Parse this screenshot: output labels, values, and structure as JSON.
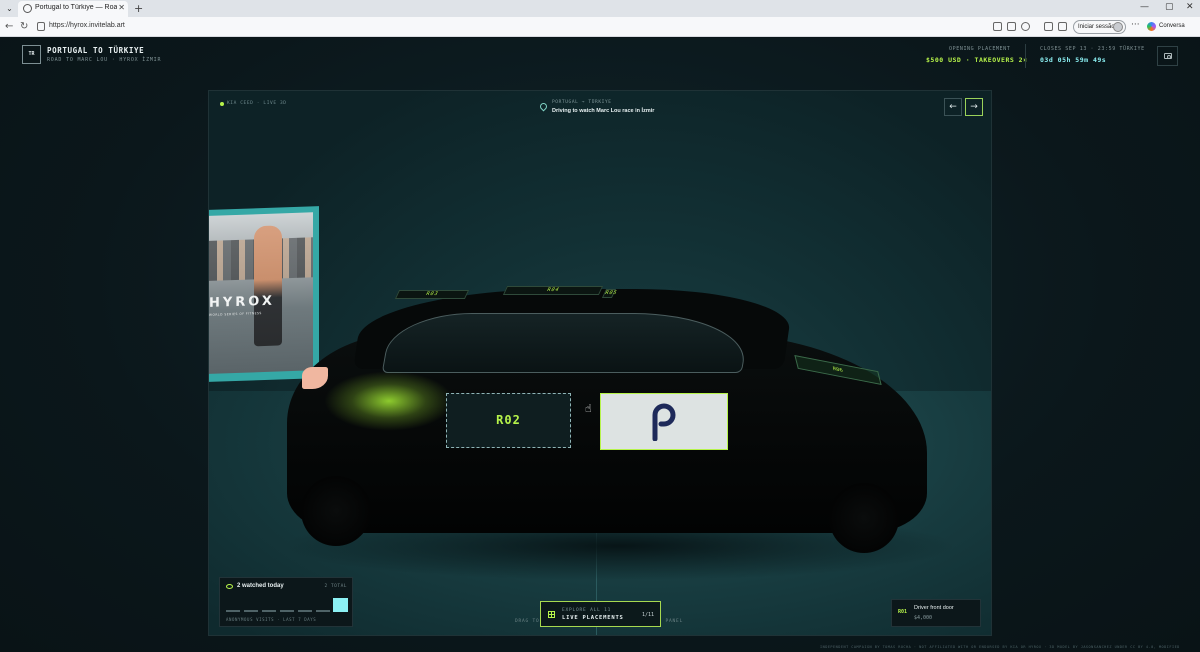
{
  "browser": {
    "tab_title": "Portugal to Türkiye — Road Trip S",
    "url": "https://hyrox.invitelab.art",
    "signin_label": "Iniciar sessão",
    "copilot_label": "Conversa"
  },
  "header": {
    "logo": "TR",
    "title": "PORTUGAL TO TÜRKIYE",
    "subtitle": "ROAD TO MARC LOU · HYROX İZMIR",
    "placement_label": "OPENING PLACEMENT",
    "placement_value": "$500 USD · TAKEOVERS 2×",
    "closes_label": "CLOSES SEP 13 · 23:59 TÜRKIYE",
    "countdown": "03d 05h 59m 49s"
  },
  "stage": {
    "live_text": "KIA CEED · LIVE 3D",
    "route_label": "PORTUGAL → TÜRKIYE",
    "route_title": "Driving to watch Marc Lou race in İzmir",
    "prev_arrow": "←",
    "next_arrow": "→",
    "billboard_brand": "HYROX",
    "billboard_sub": "WORLD SERIES OF FITNESS",
    "roof_slots": [
      "R03",
      "R04",
      "R05"
    ],
    "hood_slot": "R06",
    "slot_r02_label": "R02"
  },
  "watch": {
    "title": "2 watched today",
    "total": "2 TOTAL",
    "footer": "ANONYMOUS VISITS · LAST 7 DAYS",
    "days": [
      0,
      0,
      0,
      0,
      0,
      0,
      2
    ]
  },
  "explore": {
    "label": "EXPLORE ALL 11",
    "title": "LIVE PLACEMENTS",
    "count": "1/11",
    "hint_left": "DRAG TO",
    "hint_right": "ND PANEL"
  },
  "door": {
    "code": "R01",
    "title": "Driver front door",
    "price": "$4,000"
  },
  "footer_note": "INDEPENDENT CAMPAIGN BY TOMAS ROCHA · NOT AFFILIATED WITH OR ENDORSED BY KIA OR HYROX · 3D MODEL BY JASONSANCHEZ UNDER CC BY 4.0, MODIFIED",
  "colors": {
    "accent": "#b6f34a",
    "countdown": "#8cf1f4",
    "billboard_frame": "#35a8a6",
    "logo_panel": "#dde3e2",
    "logo_mark": "#1e2a5a"
  }
}
